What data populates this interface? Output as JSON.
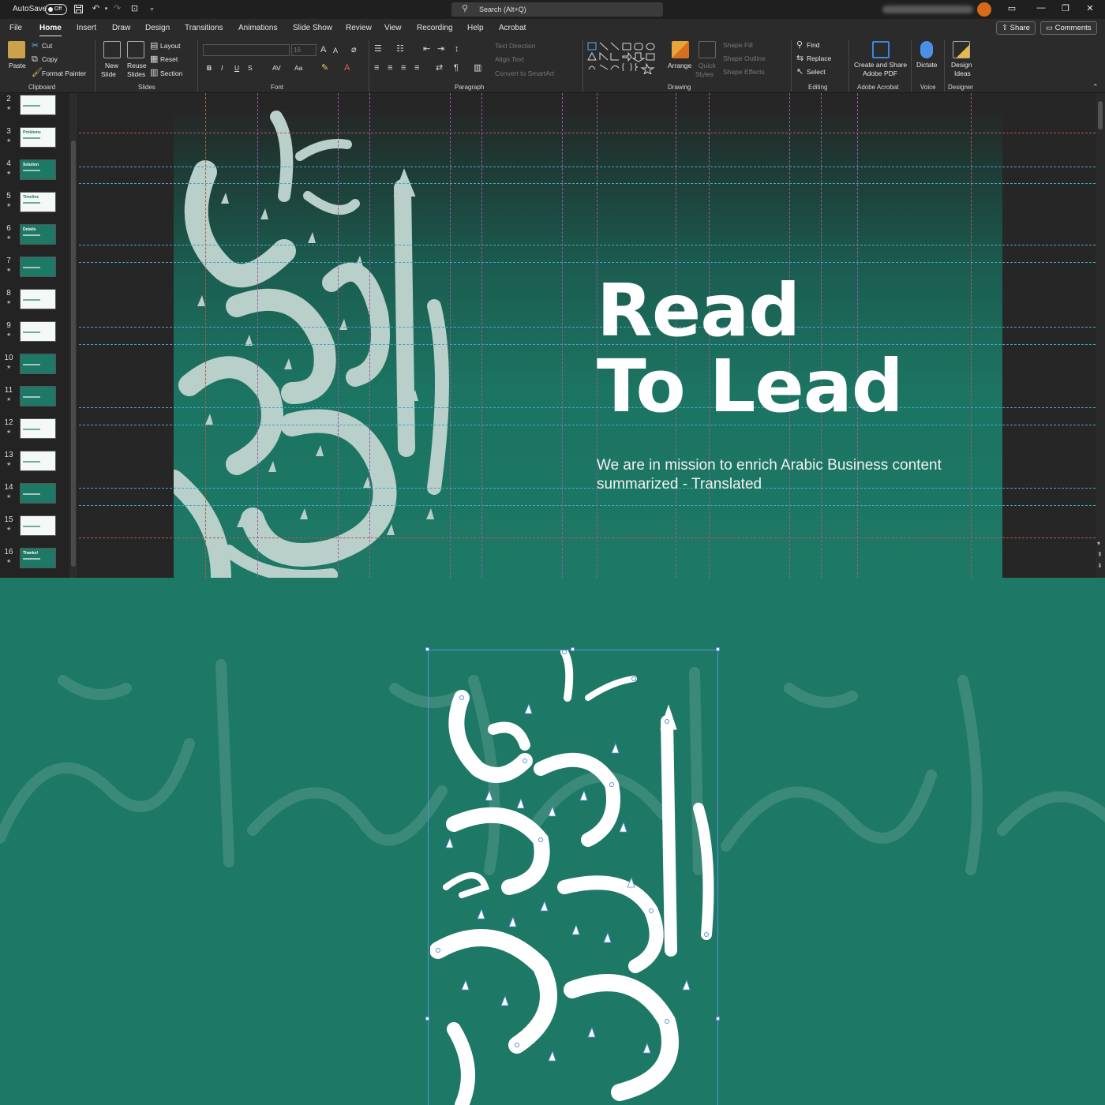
{
  "titlebar": {
    "autosave_label": "AutoSave",
    "autosave_state": "Off",
    "search_placeholder": "Search (Alt+Q)"
  },
  "tabs": [
    "File",
    "Home",
    "Insert",
    "Draw",
    "Design",
    "Transitions",
    "Animations",
    "Slide Show",
    "Review",
    "View",
    "Recording",
    "Help",
    "Acrobat"
  ],
  "active_tab": "Home",
  "actions": {
    "share": "Share",
    "comments": "Comments"
  },
  "ribbon": {
    "clipboard": {
      "paste": "Paste",
      "cut": "Cut",
      "copy": "Copy",
      "format_painter": "Format Painter",
      "label": "Clipboard"
    },
    "slides": {
      "new_slide": "New",
      "new_slide_2": "Slide",
      "reuse": "Reuse",
      "reuse_2": "Slides",
      "layout": "Layout",
      "reset": "Reset",
      "section": "Section",
      "label": "Slides"
    },
    "font": {
      "size": "16",
      "label": "Font",
      "bold": "B",
      "italic": "I",
      "underline": "U",
      "strike": "S",
      "spacing": "AV",
      "case": "Aa"
    },
    "paragraph": {
      "text_direction": "Text Direction",
      "align_text": "Align Text",
      "convert_smartart": "Convert to SmartArt",
      "label": "Paragraph"
    },
    "drawing": {
      "arrange": "Arrange",
      "quick_styles": "Quick",
      "quick_styles_2": "Styles",
      "shape_fill": "Shape Fill",
      "shape_outline": "Shape Outline",
      "shape_effects": "Shape Effects",
      "label": "Drawing"
    },
    "editing": {
      "find": "Find",
      "replace": "Replace",
      "select": "Select",
      "label": "Editing"
    },
    "acrobat": {
      "create": "Create and Share",
      "create_2": "Adobe PDF",
      "label": "Adobe Acrobat"
    },
    "voice": {
      "dictate": "Dictate",
      "label": "Voice"
    },
    "designer": {
      "ideas": "Design",
      "ideas_2": "Ideas",
      "label": "Designer"
    }
  },
  "thumbnails": [
    {
      "num": "2",
      "title": ""
    },
    {
      "num": "3",
      "title": "Problems"
    },
    {
      "num": "4",
      "title": "Solution"
    },
    {
      "num": "5",
      "title": "Timeline"
    },
    {
      "num": "6",
      "title": "Details"
    },
    {
      "num": "7",
      "title": ""
    },
    {
      "num": "8",
      "title": ""
    },
    {
      "num": "9",
      "title": ""
    },
    {
      "num": "10",
      "title": ""
    },
    {
      "num": "11",
      "title": ""
    },
    {
      "num": "12",
      "title": ""
    },
    {
      "num": "13",
      "title": ""
    },
    {
      "num": "14",
      "title": ""
    },
    {
      "num": "15",
      "title": ""
    },
    {
      "num": "16",
      "title": "Thanks!"
    }
  ],
  "slide": {
    "headline_line1": "Read",
    "headline_line2": "To Lead",
    "subline": "We are in mission to enrich Arabic Business content summarized - Translated"
  },
  "colors": {
    "brand": "#1d7865",
    "ribbon": "#2b2b2b",
    "selection": "#5a8fe0",
    "accent_avatar": "#d86a19"
  },
  "icons": [
    "save-icon",
    "undo-icon",
    "redo-icon",
    "present-icon",
    "search-icon",
    "minimize-icon",
    "restore-icon",
    "close-icon",
    "logo-book-icon"
  ]
}
